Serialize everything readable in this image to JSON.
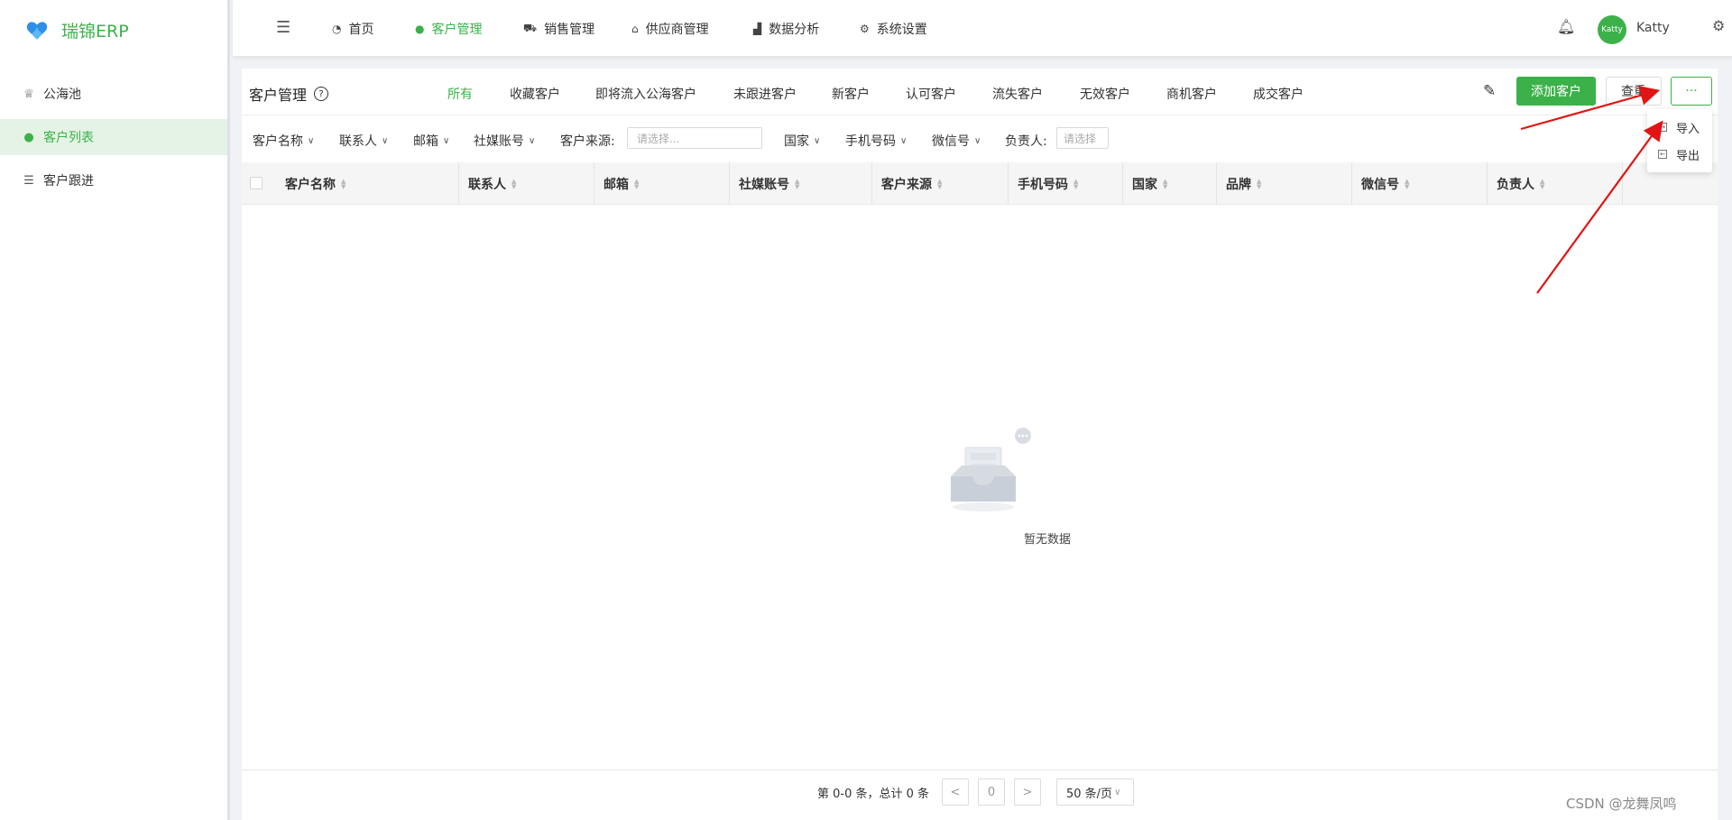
{
  "app": {
    "title": "瑞锦ERP",
    "brand_color": "#3cb14a"
  },
  "sidebar": {
    "items": [
      {
        "label": "公海池",
        "icon": "pool-icon",
        "active": false
      },
      {
        "label": "客户列表",
        "icon": "user-icon",
        "active": true
      },
      {
        "label": "客户跟进",
        "icon": "list-icon",
        "active": false
      }
    ]
  },
  "topnav": {
    "items": [
      {
        "label": "首页",
        "icon": "dashboard-icon"
      },
      {
        "label": "客户管理",
        "icon": "customer-icon",
        "active": true
      },
      {
        "label": "销售管理",
        "icon": "cart-icon"
      },
      {
        "label": "供应商管理",
        "icon": "bank-icon"
      },
      {
        "label": "数据分析",
        "icon": "chart-icon"
      },
      {
        "label": "系统设置",
        "icon": "gear-icon"
      }
    ],
    "user": {
      "avatar_text": "Katty",
      "name": "Katty"
    }
  },
  "page": {
    "title": "客户管理",
    "tabs": [
      "所有",
      "收藏客户",
      "即将流入公海客户",
      "未跟进客户",
      "新客户",
      "认可客户",
      "流失客户",
      "无效客户",
      "商机客户",
      "成交客户"
    ],
    "active_tab": "所有",
    "add_button": "添加客户",
    "view_button": "查重",
    "more_button": "···",
    "more_menu": [
      "导入",
      "导出"
    ]
  },
  "filters": {
    "customer_name": "客户名称",
    "contact": "联系人",
    "email": "邮箱",
    "social": "社媒账号",
    "source_label": "客户来源:",
    "source_placeholder": "请选择...",
    "country": "国家",
    "phone": "手机号码",
    "wechat": "微信号",
    "owner_label": "负责人:",
    "owner_placeholder": "请选择"
  },
  "table": {
    "columns": [
      "客户名称",
      "联系人",
      "邮箱",
      "社媒账号",
      "客户来源",
      "手机号码",
      "国家",
      "品牌",
      "微信号",
      "负责人"
    ],
    "rows": [],
    "empty_text": "暂无数据"
  },
  "pagination": {
    "total_text": "第 0-0 条，总计 0 条",
    "current_page": "0",
    "prev": "<",
    "next": ">",
    "page_size": "50 条/页"
  },
  "watermark": "CSDN @龙舞凤鸣"
}
